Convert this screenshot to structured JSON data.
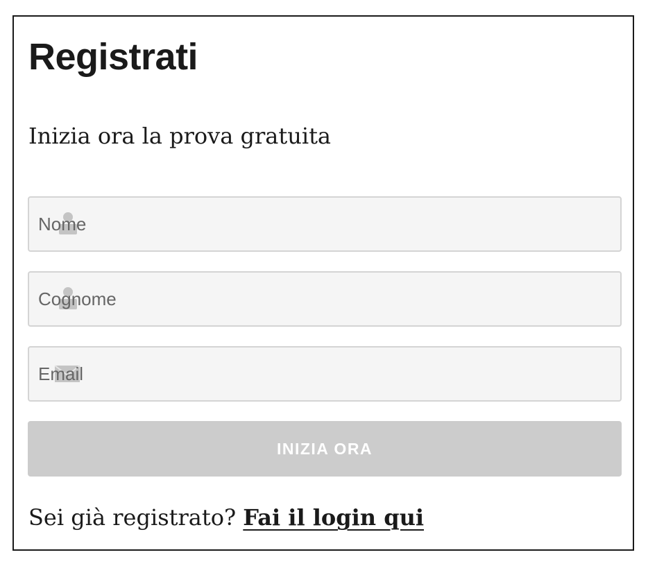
{
  "form": {
    "title": "Registrati",
    "subtitle": "Inizia ora la prova gratuita",
    "fields": {
      "first_name": {
        "placeholder": "Nome",
        "value": "",
        "icon": "user-icon"
      },
      "last_name": {
        "placeholder": "Cognome",
        "value": "",
        "icon": "user-icon"
      },
      "email": {
        "placeholder": "Email",
        "value": "",
        "icon": "envelope-icon"
      }
    },
    "submit_label": "INIZIA ORA",
    "login_prompt": "Sei già registrato?",
    "login_link": "Fai il login qui"
  },
  "colors": {
    "text": "#1a1a1a",
    "field_bg": "#f5f5f5",
    "field_border": "#d4d4d4",
    "button_bg": "#cccccc",
    "button_text": "#ffffff",
    "icon": "#c4c4c4"
  }
}
